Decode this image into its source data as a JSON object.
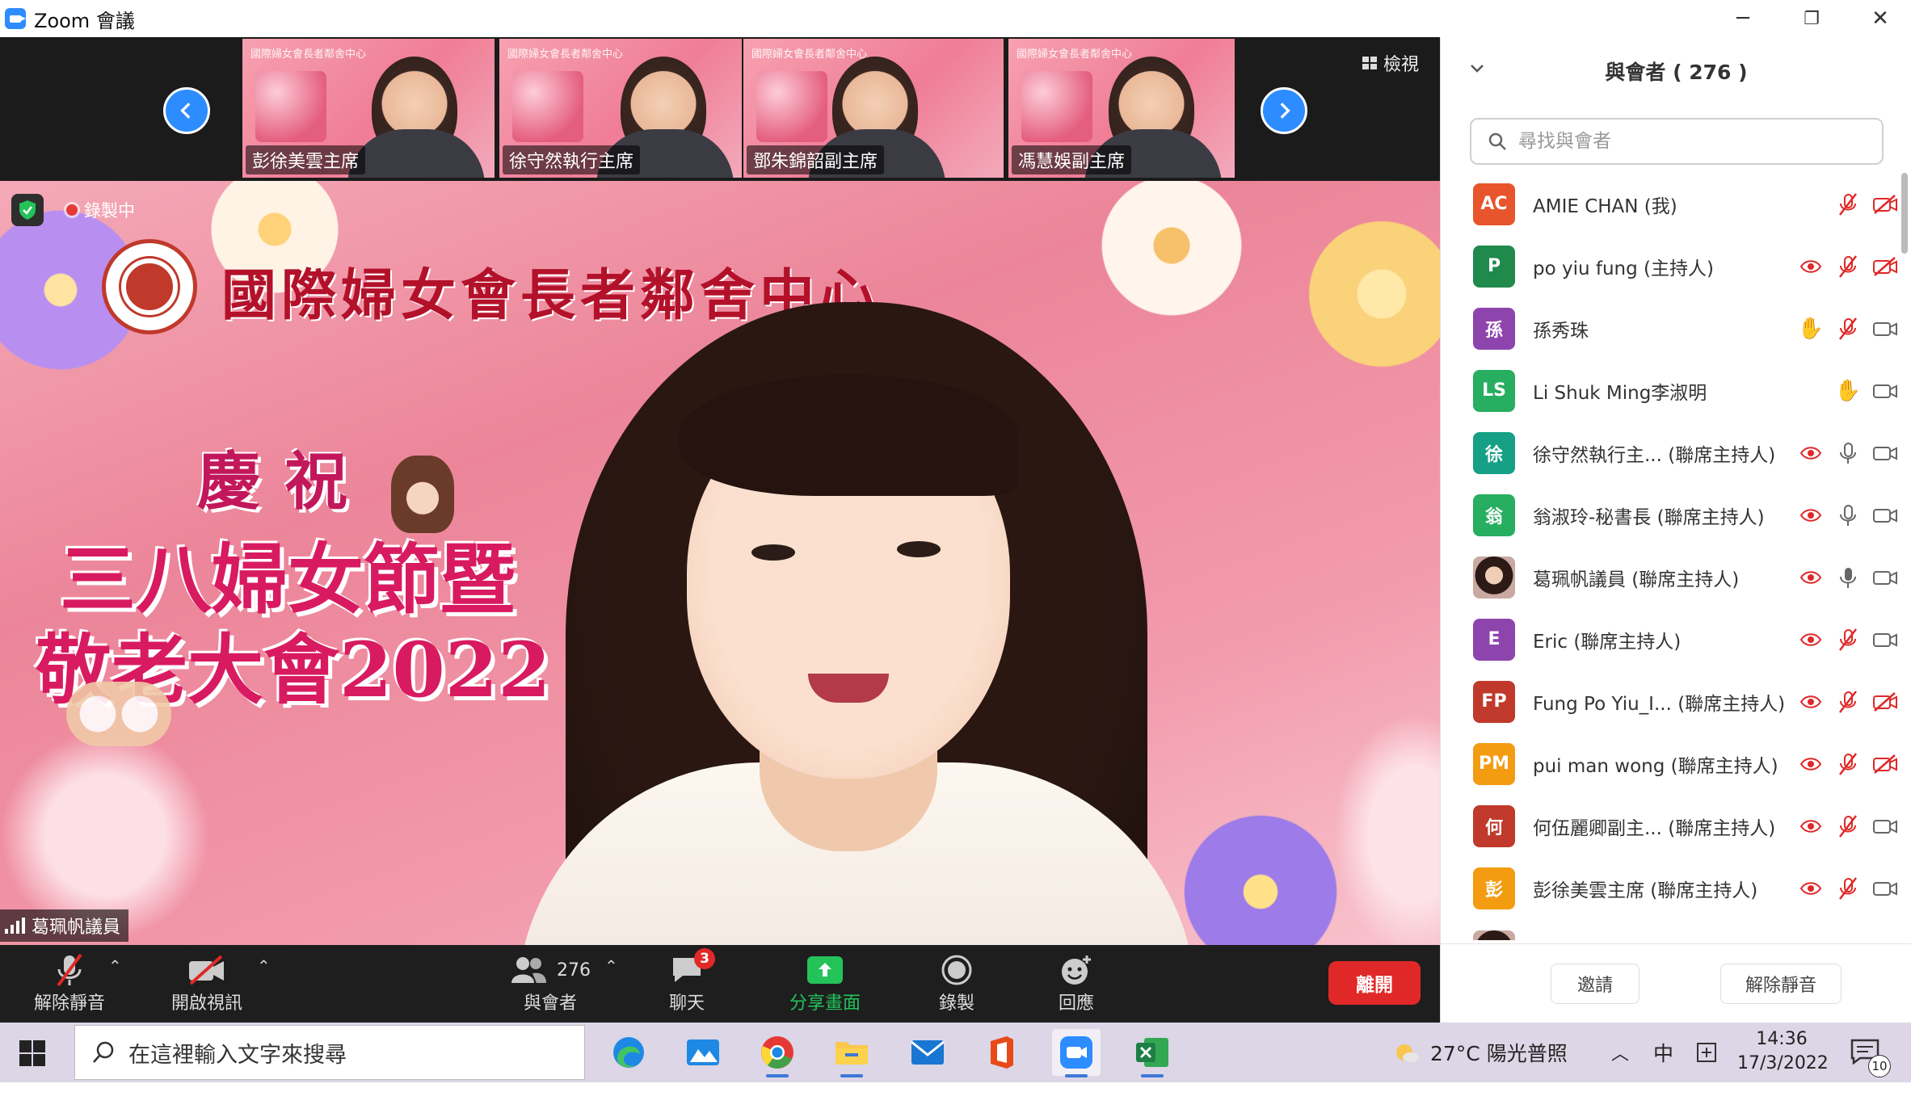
{
  "window": {
    "title": "Zoom 會議",
    "minimize": "─",
    "restore": "❐",
    "close": "✕"
  },
  "thumbnails": [
    {
      "label": "彭徐美雲主席",
      "banner": "國際婦女會長者鄰舍中心"
    },
    {
      "label": "徐守然執行主席",
      "banner": "國際婦女會長者鄰舍中心"
    },
    {
      "label": "鄧朱錦韶副主席",
      "banner": "國際婦女會長者鄰舍中心"
    },
    {
      "label": "馮慧娛副主席",
      "banner": "國際婦女會長者鄰舍中心"
    }
  ],
  "view_button": "檢視",
  "main_video": {
    "recording": "錄製中",
    "org_name": "國際婦女會長者鄰舍中心",
    "title_line1": "慶祝",
    "title_line2": "三八婦女節暨",
    "title_line3": "敬老大會2022",
    "speaker": "葛珮帆議員"
  },
  "toolbar": {
    "unmute": "解除靜音",
    "start_video": "開啟視訊",
    "participants": "與會者",
    "participants_count": "276",
    "chat": "聊天",
    "chat_badge": "3",
    "share": "分享畫面",
    "record": "錄製",
    "reactions": "回應",
    "leave": "離開"
  },
  "panel": {
    "title": "與會者 ( 276 )",
    "search_placeholder": "尋找與會者",
    "invite": "邀請",
    "unmute_all": "解除靜音",
    "participants": [
      {
        "initials": "AC",
        "name": "AMIE CHAN (我)",
        "color": "#e8542b"
      },
      {
        "initials": "P",
        "name": "po yiu fung (主持人)",
        "color": "#1f8a4c"
      },
      {
        "initials": "孫",
        "name": "孫秀珠",
        "color": "#8e44ad"
      },
      {
        "initials": "LS",
        "name": "Li Shuk Ming李淑明",
        "color": "#27ae60"
      },
      {
        "initials": "徐",
        "name": "徐守然執行主... (聯席主持人)",
        "color": "#16a085"
      },
      {
        "initials": "翁",
        "name": "翁淑玲-秘書長 (聯席主持人)",
        "color": "#27ae60"
      },
      {
        "initials": "",
        "name": "葛珮帆議員 (聯席主持人)",
        "color": "#555555"
      },
      {
        "initials": "E",
        "name": "Eric (聯席主持人)",
        "color": "#8e44ad"
      },
      {
        "initials": "FP",
        "name": "Fung Po Yiu_I... (聯席主持人)",
        "color": "#c0392b"
      },
      {
        "initials": "PM",
        "name": "pui man wong (聯席主持人)",
        "color": "#f39c12"
      },
      {
        "initials": "何",
        "name": "何伍麗卿副主... (聯席主持人)",
        "color": "#c0392b"
      },
      {
        "initials": "彭",
        "name": "彭徐美雲主席 (聯席主持人)",
        "color": "#f39c12"
      }
    ]
  },
  "taskbar": {
    "search_placeholder": "在這裡輸入文字來搜尋",
    "weather": "27°C 陽光普照",
    "ime": "中",
    "time": "14:36",
    "date": "17/3/2022",
    "notifications": "10"
  }
}
